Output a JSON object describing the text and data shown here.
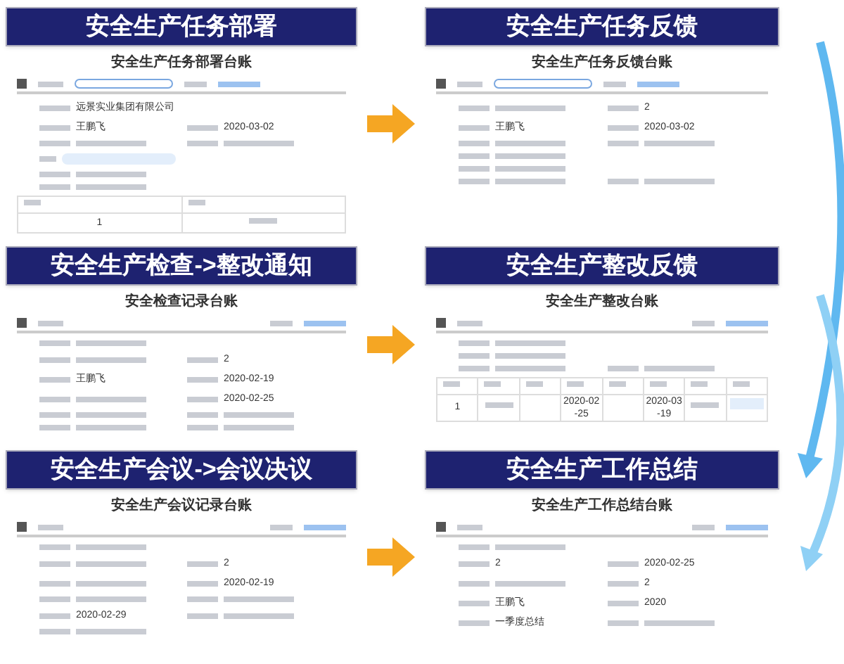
{
  "rows": [
    {
      "left": {
        "title": "安全生产任务部署",
        "sheet_title": "安全生产任务部署台账",
        "pill": true,
        "fields": [
          {
            "left": {
              "kind": "text",
              "text": "远景实业集团有限公司"
            },
            "right": {
              "kind": "none"
            }
          },
          {
            "left": {
              "kind": "text",
              "text": "王鹏飞"
            },
            "right": {
              "kind": "text",
              "text": "2020-03-02"
            }
          },
          {
            "left": {
              "kind": "blur"
            },
            "right": {
              "kind": "blur"
            }
          },
          {
            "left": {
              "kind": "link"
            },
            "right": {
              "kind": "none"
            }
          },
          {
            "left": {
              "kind": "blur"
            },
            "right": {
              "kind": "none"
            }
          },
          {
            "left": {
              "kind": "blur"
            },
            "right": {
              "kind": "none"
            }
          }
        ],
        "table": {
          "rows": [
            [
              {
                "kind": "text",
                "text": "1"
              },
              {
                "kind": "blur"
              }
            ]
          ]
        }
      },
      "right": {
        "title": "安全生产任务反馈",
        "sheet_title": "安全生产任务反馈台账",
        "pill": true,
        "fields": [
          {
            "left": {
              "kind": "blur"
            },
            "right": {
              "kind": "text",
              "text": "2"
            }
          },
          {
            "left": {
              "kind": "text",
              "text": "王鹏飞"
            },
            "right": {
              "kind": "text",
              "text": "2020-03-02"
            }
          },
          {
            "left": {
              "kind": "blur"
            },
            "right": {
              "kind": "blur"
            }
          },
          {
            "left": {
              "kind": "blur"
            },
            "right": {
              "kind": "none"
            }
          },
          {
            "left": {
              "kind": "blur"
            },
            "right": {
              "kind": "none"
            }
          },
          {
            "left": {
              "kind": "blur"
            },
            "right": {
              "kind": "blur"
            }
          }
        ]
      }
    },
    {
      "left": {
        "title": "安全生产检查->整改通知",
        "sheet_title": "安全检查记录台账",
        "pill": false,
        "fields": [
          {
            "left": {
              "kind": "blur"
            },
            "right": {
              "kind": "none"
            }
          },
          {
            "left": {
              "kind": "blur"
            },
            "right": {
              "kind": "text",
              "text": "2"
            }
          },
          {
            "left": {
              "kind": "text",
              "text": "王鹏飞"
            },
            "right": {
              "kind": "text",
              "text": "2020-02-19"
            }
          },
          {
            "left": {
              "kind": "blur"
            },
            "right": {
              "kind": "text",
              "text": "2020-02-25"
            }
          },
          {
            "left": {
              "kind": "blur"
            },
            "right": {
              "kind": "blur"
            }
          },
          {
            "left": {
              "kind": "blur"
            },
            "right": {
              "kind": "blur"
            }
          }
        ]
      },
      "right": {
        "title": "安全生产整改反馈",
        "sheet_title": "安全生产整改台账",
        "pill": false,
        "fields": [
          {
            "left": {
              "kind": "blur"
            },
            "right": {
              "kind": "none"
            }
          },
          {
            "left": {
              "kind": "blur"
            },
            "right": {
              "kind": "none"
            }
          },
          {
            "left": {
              "kind": "blur"
            },
            "right": {
              "kind": "blur"
            }
          }
        ],
        "table": {
          "rows": [
            [
              {
                "kind": "text",
                "text": "1"
              },
              {
                "kind": "blur"
              },
              {
                "kind": "none"
              },
              {
                "kind": "text",
                "text": "2020-02-25"
              },
              {
                "kind": "none"
              },
              {
                "kind": "text",
                "text": "2020-03-19"
              },
              {
                "kind": "blur"
              },
              {
                "kind": "link"
              }
            ]
          ]
        }
      }
    },
    {
      "left": {
        "title": "安全生产会议->会议决议",
        "sheet_title": "安全生产会议记录台账",
        "pill": false,
        "fields": [
          {
            "left": {
              "kind": "blur"
            },
            "right": {
              "kind": "none"
            }
          },
          {
            "left": {
              "kind": "blur"
            },
            "right": {
              "kind": "text",
              "text": "2"
            }
          },
          {
            "left": {
              "kind": "blur"
            },
            "right": {
              "kind": "text",
              "text": "2020-02-19"
            }
          },
          {
            "left": {
              "kind": "blur"
            },
            "right": {
              "kind": "blur"
            }
          },
          {
            "left": {
              "kind": "text",
              "text": "2020-02-29"
            },
            "right": {
              "kind": "blur"
            }
          },
          {
            "left": {
              "kind": "blur"
            },
            "right": {
              "kind": "none"
            }
          }
        ]
      },
      "right": {
        "title": "安全生产工作总结",
        "sheet_title": "安全生产工作总结台账",
        "pill": false,
        "fields": [
          {
            "left": {
              "kind": "blur"
            },
            "right": {
              "kind": "none"
            }
          },
          {
            "left": {
              "kind": "text",
              "text": "2"
            },
            "right": {
              "kind": "text",
              "text": "2020-02-25"
            }
          },
          {
            "left": {
              "kind": "blur"
            },
            "right": {
              "kind": "text",
              "text": "2"
            }
          },
          {
            "left": {
              "kind": "text",
              "text": "王鹏飞"
            },
            "right": {
              "kind": "text",
              "text": "2020"
            }
          },
          {
            "left": {
              "kind": "text",
              "text": "一季度总结"
            },
            "right": {
              "kind": "blur"
            }
          }
        ]
      }
    }
  ]
}
